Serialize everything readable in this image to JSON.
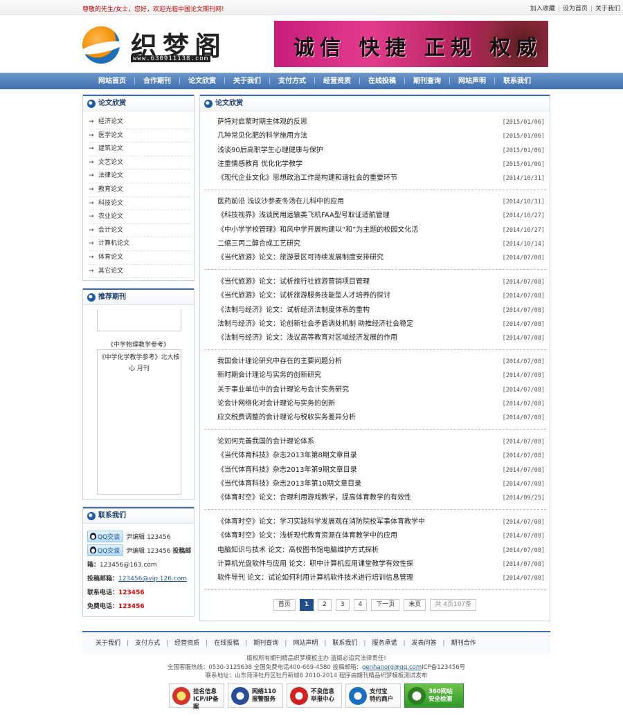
{
  "topbar": {
    "welcome": "尊敬的先生/女士，您好，欢迎光临中国论文期刊网!",
    "links": [
      "加入收藏",
      "设为首页",
      "关于我们"
    ]
  },
  "header": {
    "logo_text": "织梦阁",
    "logo_domain": "www.630911138.com",
    "banner_text": "诚信 快捷 正规 权威"
  },
  "nav": {
    "items": [
      "网站首页",
      "合作期刊",
      "论文欣赏",
      "关于我们",
      "支付方式",
      "经营资质",
      "在线投稿",
      "期刊查询",
      "网站声明",
      "联系我们"
    ]
  },
  "sidebar": {
    "categories_title": "论文欣赏",
    "categories": [
      "经济论文",
      "医学论文",
      "建筑论文",
      "文艺论文",
      "法律论文",
      "教育论文",
      "科技论文",
      "农业论文",
      "会计论文",
      "计算机论文",
      "体育论文",
      "其它论文"
    ],
    "recommend_title": "推荐期刊",
    "recommend_item1": "《中学物理教学参考》",
    "recommend_item2": "《中学化学教学参考》北大核心 月刊",
    "contact_title": "联系我们",
    "contact": {
      "qq_label": "QQ交谈",
      "qq1_name": "尹编辑",
      "qq1_num": "123456",
      "qq2_name": "尹编辑",
      "qq2_num": "123456",
      "qq2_extra": "投稿邮",
      "mail_label": "箱：",
      "mail_value": "123456@163.com",
      "submit_label": "投稿邮箱：",
      "submit_value": "123456@vip.126.com",
      "phone_label": "联系电话：",
      "phone_value": "123456",
      "free_label": "免费电话：",
      "free_value": "123456"
    }
  },
  "main": {
    "title": "论文欣赏",
    "groups": [
      [
        {
          "title": "萨特对启蒙时期主体观的反思",
          "date": "[2015/01/06]"
        },
        {
          "title": "几种常见化肥的科学施用方法",
          "date": "[2015/01/06]"
        },
        {
          "title": "浅谈90后高职学生心理健康与保护",
          "date": "[2015/01/06]"
        },
        {
          "title": "注重情感教育 优化化学教学",
          "date": "[2015/01/06]"
        },
        {
          "title": "《现代企业文化》思想政治工作是构建和谐社会的重要环节",
          "date": "[2014/10/31]"
        }
      ],
      [
        {
          "title": "医药前沿 浅议沙参麦冬汤在儿科中的应用",
          "date": "[2014/10/31]"
        },
        {
          "title": "《科技视界》浅谈民用运输类飞机FAA型号取证适航管理",
          "date": "[2014/10/27]"
        },
        {
          "title": "《中小学学校管理》和风中学开展构建以“和”为主题的校园文化活",
          "date": "[2014/10/27]"
        },
        {
          "title": "二缩三丙二醇合成工艺研究",
          "date": "[2014/10/14]"
        },
        {
          "title": "《当代旅游》论文：旅游景区可持续发展制度安排研究",
          "date": "[2014/07/08]"
        }
      ],
      [
        {
          "title": "《当代旅游》论文：试析旅行社旅游营销项目管理",
          "date": "[2014/07/08]"
        },
        {
          "title": "《当代旅游》论文：试析旅游服务技能型人才培养的探讨",
          "date": "[2014/07/08]"
        },
        {
          "title": "《法制与经济》论文：试析经济法制度体系的重构",
          "date": "[2014/07/08]"
        },
        {
          "title": "法制与经济》论文：论创新社会矛盾调处机制 助推经济社会稳定",
          "date": "[2014/07/08]"
        },
        {
          "title": "《法制与经济》论文：浅议高等教育对区域经济发展的作用",
          "date": "[2014/07/08]"
        }
      ],
      [
        {
          "title": "我国会计理论研究中存在的主要问题分析",
          "date": "[2014/07/08]"
        },
        {
          "title": "新时期会计理论与实务的创新研究",
          "date": "[2014/07/08]"
        },
        {
          "title": "关于事业单位中的会计理论与会计实务研究",
          "date": "[2014/07/08]"
        },
        {
          "title": "论会计网络化对会计理论与实务的创新",
          "date": "[2014/07/08]"
        },
        {
          "title": "应交税费调整的会计理论与税收实务差异分析",
          "date": "[2014/07/08]"
        }
      ],
      [
        {
          "title": "论如何完善我国的会计理论体系",
          "date": "[2014/07/08]"
        },
        {
          "title": "《当代体育科技》杂志2013年第8期文章目录",
          "date": "[2014/07/08]"
        },
        {
          "title": "《当代体育科技》杂志2013年第9期文章目录",
          "date": "[2014/07/08]"
        },
        {
          "title": "《当代体育科技》杂志2013年第10期文章目录",
          "date": "[2014/07/08]"
        },
        {
          "title": "《体育时空》论文：合理利用游戏教学，提高体育教学的有效性",
          "date": "[2014/09/25]"
        }
      ],
      [
        {
          "title": "《体育时空》论文：学习实践科学发展观在消防院校军事体育教学中",
          "date": "[2014/07/08]"
        },
        {
          "title": "《体育时空》论文：浅析现代教育资源在体育教学中的应用",
          "date": "[2014/07/08]"
        },
        {
          "title": "电脑知识与技术 论文：高校图书馆电脑维护方式探析",
          "date": "[2014/07/08]"
        },
        {
          "title": "计算机光盘软件与应用 论文：职中计算机应用课堂教学有效性探",
          "date": "[2014/07/08]"
        },
        {
          "title": "软件导刊 论文：试论如何利用计算机软件技术进行培训信息管理",
          "date": "[2014/07/08]"
        }
      ]
    ]
  },
  "pager": {
    "first": "首页",
    "pages": [
      "1",
      "2",
      "3",
      "4"
    ],
    "current": "1",
    "next": "下一页",
    "last": "末页",
    "info": "共 4页107条"
  },
  "footer": {
    "nav": [
      "关于我们",
      "支付方式",
      "经营资质",
      "在线投稿",
      "期刊查询",
      "网站声明",
      "联系我们",
      "服务承诺",
      "发表问答",
      "期刊合作"
    ],
    "line1": "版权所有期刊精品织梦模板主办 盗版必追究法律责任!",
    "line2": "全国客服热线：0530-3125638   全国免费电话400-669-4580   投稿邮箱：",
    "line2_email": "genhanorg@qq.com",
    "line2_icp": "ICP备123456号",
    "line3": "联系地址：山东菏泽牡丹区牡丹新城6 2010-2014 程序由期刊精品织梦模板测试发布",
    "badges": [
      {
        "label": "挂名信息 ICP/IP备案",
        "icon": "shield-badge-icon"
      },
      {
        "label": "网络110 报警服务",
        "icon": "police-badge-icon"
      },
      {
        "label": "不良信息 举报中心",
        "icon": "report-badge-icon"
      },
      {
        "label": "支付宝 特约商户",
        "icon": "alipay-badge-icon"
      },
      {
        "label": "360网站 安全检测",
        "icon": "360-badge-icon"
      }
    ]
  }
}
